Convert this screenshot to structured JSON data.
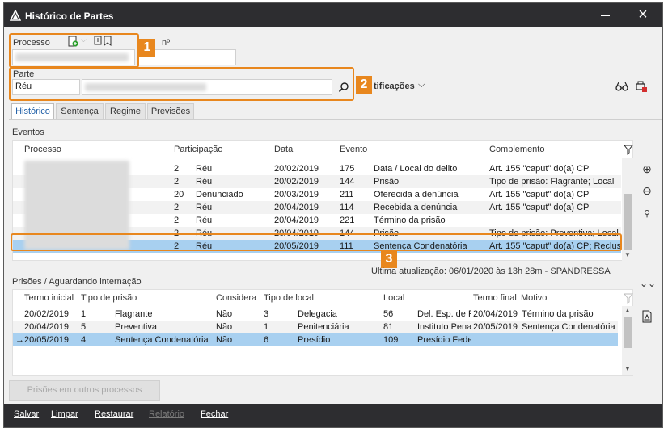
{
  "window": {
    "title": "Histórico de Partes"
  },
  "processo": {
    "label": "Processo",
    "numero_label": "nº"
  },
  "parte": {
    "label": "Parte",
    "tipo": "Réu",
    "notificacoes_label": "tificações"
  },
  "callouts": [
    "1",
    "2",
    "3"
  ],
  "tabs": [
    {
      "label": "Histórico",
      "active": true
    },
    {
      "label": "Sentença",
      "active": false
    },
    {
      "label": "Regime",
      "active": false
    },
    {
      "label": "Previsões",
      "active": false
    }
  ],
  "eventos": {
    "section_label": "Eventos",
    "columns": [
      "Processo",
      "Participação",
      "",
      "Data",
      "Evento",
      "",
      "Complemento"
    ],
    "rows": [
      {
        "n": "2",
        "part": "Réu",
        "data": "20/02/2019",
        "cod": "175",
        "evento": "Data / Local do delito",
        "comp": "Art. 155 \"caput\" do(a) CP"
      },
      {
        "n": "2",
        "part": "Réu",
        "data": "20/02/2019",
        "cod": "144",
        "evento": "Prisão",
        "comp": "Tipo de prisão: Flagrante; Local"
      },
      {
        "n": "20",
        "part": "Denunciado",
        "data": "20/03/2019",
        "cod": "211",
        "evento": "Oferecida a denúncia",
        "comp": "Art. 155 \"caput\" do(a) CP"
      },
      {
        "n": "2",
        "part": "Réu",
        "data": "20/04/2019",
        "cod": "114",
        "evento": "Recebida a denúncia",
        "comp": "Art. 155 \"caput\" do(a) CP"
      },
      {
        "n": "2",
        "part": "Réu",
        "data": "20/04/2019",
        "cod": "221",
        "evento": "Término da prisão",
        "comp": ""
      },
      {
        "n": "2",
        "part": "Réu",
        "data": "20/04/2019",
        "cod": "144",
        "evento": "Prisão",
        "comp": "Tipo de prisão: Preventiva; Local"
      },
      {
        "n": "2",
        "part": "Réu",
        "data": "20/05/2019",
        "cod": "111",
        "evento": "Sentença Condenatória",
        "comp": "Art. 155 \"caput\" do(a) CP; Reclus"
      }
    ],
    "ultima_atualizacao": "Última atualização:  06/01/2020 às 13h 28m  - SPANDRESSA"
  },
  "prisoes": {
    "section_label": "Prisões / Aguardando internação",
    "columns": [
      "Termo inicial",
      "Tipo de prisão",
      "",
      "Considera",
      "Tipo de local",
      "",
      "Local",
      "",
      "Termo final",
      "Motivo"
    ],
    "rows": [
      {
        "marker": "",
        "inicio": "20/02/2019",
        "tp": "1",
        "tipo": "Flagrante",
        "considera": "Não",
        "tl": "3",
        "tipolocal": "Delegacia",
        "loc": "56",
        "local": "Del. Esp. de P",
        "fim": "20/04/2019",
        "motivo": "Término da prisão"
      },
      {
        "marker": "",
        "inicio": "20/04/2019",
        "tp": "5",
        "tipo": "Preventiva",
        "considera": "Não",
        "tl": "1",
        "tipolocal": "Penitenciária",
        "loc": "81",
        "local": "Instituto Pena",
        "fim": "20/05/2019",
        "motivo": "Sentença Condenatória"
      },
      {
        "marker": "→",
        "inicio": "20/05/2019",
        "tp": "4",
        "tipo": "Sentença Condenatória",
        "considera": "Não",
        "tl": "6",
        "tipolocal": "Presídio",
        "loc": "109",
        "local": "Presídio Fede",
        "fim": "",
        "motivo": ""
      }
    ]
  },
  "buttons": {
    "prisoes_outros": "Prisões em outros processos"
  },
  "bottom_menu": [
    {
      "label": "Salvar",
      "enabled": true
    },
    {
      "label": "Limpar",
      "enabled": true
    },
    {
      "label": "Restaurar",
      "enabled": true
    },
    {
      "label": "Relatório",
      "enabled": false
    },
    {
      "label": "Fechar",
      "enabled": true
    }
  ],
  "colors": {
    "accent": "#e8871e",
    "selection": "#a8d0f0",
    "titlebar": "#2d2d30",
    "tab_active": "#1f5fa8"
  }
}
